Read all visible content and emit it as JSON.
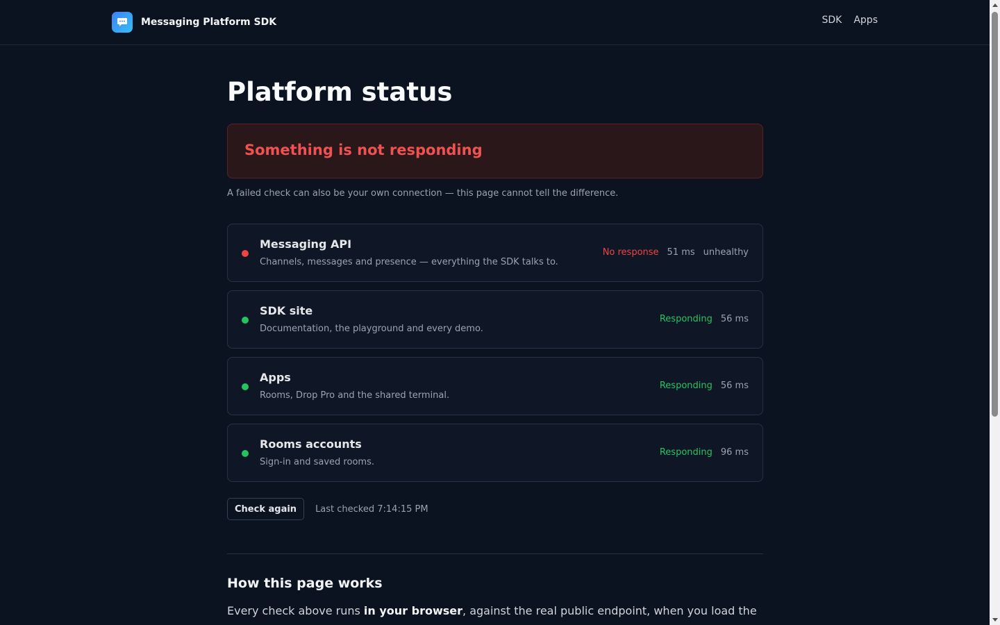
{
  "header": {
    "brand": "Messaging Platform SDK",
    "logo_icon": "chat-bubble-icon",
    "nav": [
      "SDK",
      "Apps"
    ]
  },
  "page": {
    "title": "Platform status",
    "alert": "Something is not responding",
    "note": "A failed check can also be your own connection — this page cannot tell the difference."
  },
  "services": [
    {
      "name": "Messaging API",
      "description": "Channels, messages and presence — everything the SDK talks to.",
      "status": "No response",
      "latency": "51 ms",
      "health": "unhealthy",
      "state": "down"
    },
    {
      "name": "SDK site",
      "description": "Documentation, the playground and every demo.",
      "status": "Responding",
      "latency": "56 ms",
      "health": "",
      "state": "up"
    },
    {
      "name": "Apps",
      "description": "Rooms, Drop Pro and the shared terminal.",
      "status": "Responding",
      "latency": "56 ms",
      "health": "",
      "state": "up"
    },
    {
      "name": "Rooms accounts",
      "description": "Sign-in and saved rooms.",
      "status": "Responding",
      "latency": "96 ms",
      "health": "",
      "state": "up"
    }
  ],
  "actions": {
    "check_again": "Check again",
    "last_checked": "Last checked 7:14:15 PM"
  },
  "how": {
    "title": "How this page works",
    "text_before": "Every check above runs ",
    "text_bold": "in your browser",
    "text_after": ", against the real public endpoint, when you load the"
  },
  "colors": {
    "background": "#0b1220",
    "error": "#ef4444",
    "success": "#22c55e",
    "accent": "#3b82f6"
  }
}
